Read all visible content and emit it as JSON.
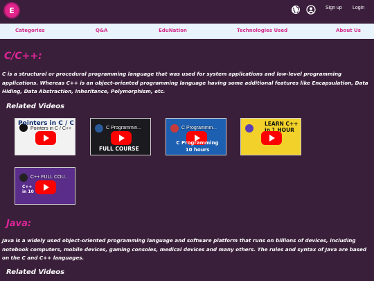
{
  "header": {
    "logo_letter": "E",
    "signup": "Sign up",
    "login": "Login"
  },
  "nav": {
    "items": [
      "Categories",
      "Q&A",
      "EduNation",
      "Technologies Used",
      "About Us"
    ]
  },
  "sections": [
    {
      "title": "C/C++:",
      "description": "C is a structural or procedural programming language that was used for system applications and low-level programming applications. Whereas C++ is an object-oriented programming language having some additional features like Encapsulation, Data Hiding, Data Abstraction, Inheritance, Polymorphism, etc.",
      "related": "Related Videos",
      "videos": [
        {
          "title": "Pointers in C / C++",
          "overlay": "Pointers in C / C++"
        },
        {
          "title": "C Programmin...",
          "overlay": "FULL COURSE"
        },
        {
          "title": "C Programmin...",
          "overlay": "C Programming 10 hours"
        },
        {
          "title": "LEARN C++ in 1 HOUR",
          "overlay": "LEARN C++ in 1 HOUR"
        },
        {
          "title": "C++ FULL COU...",
          "overlay": "C++ in 10"
        }
      ]
    },
    {
      "title": "Java:",
      "description": "Java is a widely used object-oriented programming language and software platform that runs on billions of devices, including notebook computers, mobile devices, gaming consoles, medical devices and many others. The rules and syntax of Java are based on the C and C++ languages.",
      "related": "Related Videos"
    }
  ],
  "colors": {
    "background": "#3a1f3a",
    "accent": "#e0259a",
    "nav_bg": "#e9f3fb",
    "play": "#ff0000"
  }
}
